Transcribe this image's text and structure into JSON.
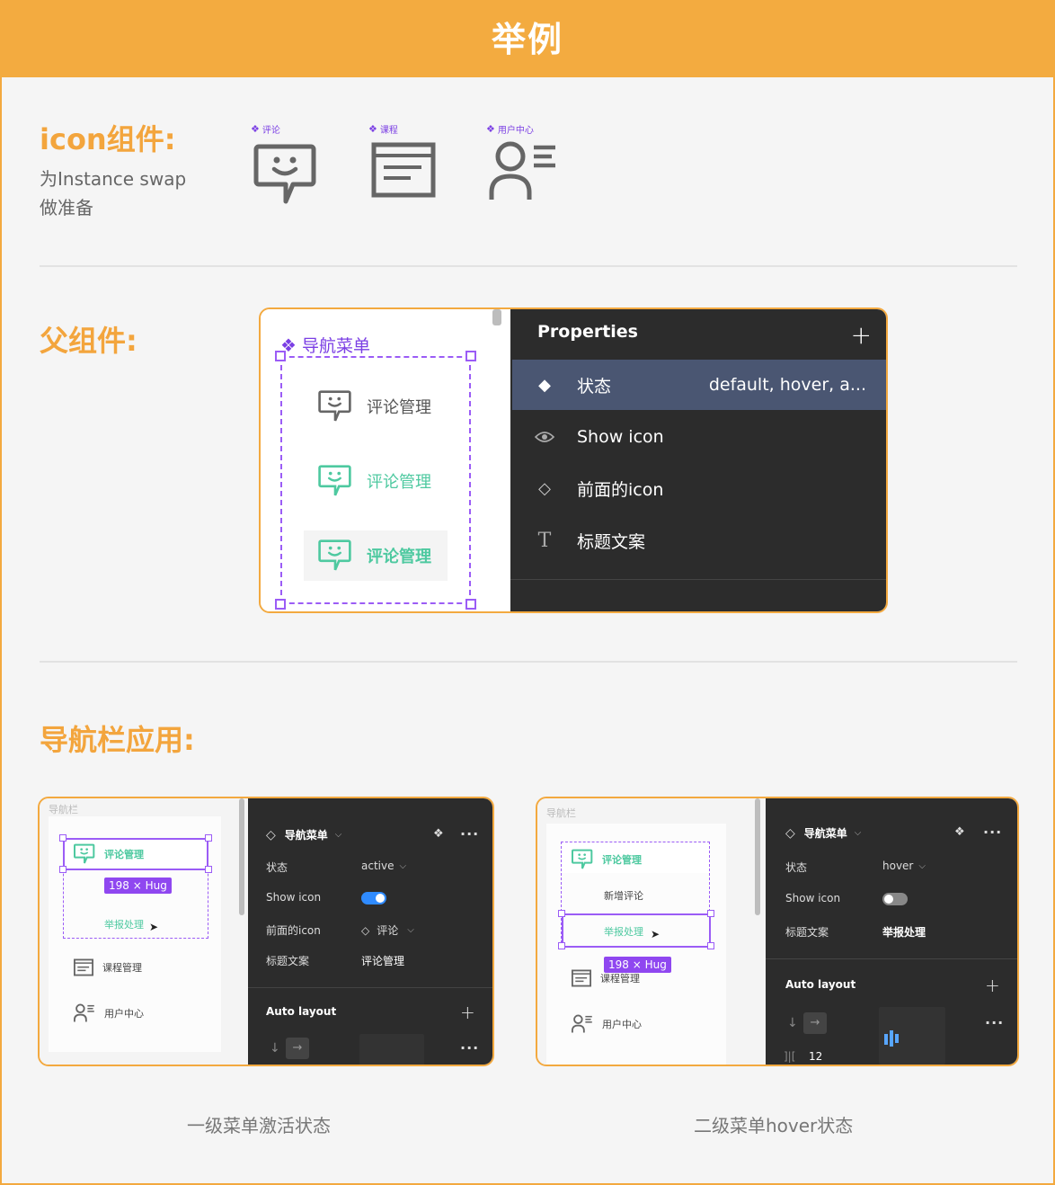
{
  "header": {
    "title": "举例"
  },
  "icon_section": {
    "title": "icon组件:",
    "desc_line1": "为Instance swap",
    "desc_line2": "做准备",
    "icons": [
      {
        "label": "评论",
        "icon": "comment-smile-icon"
      },
      {
        "label": "课程",
        "icon": "course-document-icon"
      },
      {
        "label": "用户中心",
        "icon": "user-center-icon"
      }
    ]
  },
  "parent_section": {
    "title": "父组件:",
    "component_name": "导航菜单",
    "menu_items": [
      "评论管理",
      "评论管理",
      "评论管理"
    ],
    "properties_title": "Properties",
    "properties": [
      {
        "label": "状态",
        "value": "default, hover, a..."
      },
      {
        "label": "Show icon",
        "value": ""
      },
      {
        "label": "前面的icon",
        "value": ""
      },
      {
        "label": "标题文案",
        "value": ""
      }
    ]
  },
  "nav_section": {
    "title": "导航栏应用:",
    "card1": {
      "frame_label": "导航栏",
      "item_active": "评论管理",
      "hug": "198 × Hug",
      "item_report": "举报处理",
      "item_course": "课程管理",
      "item_user": "用户中心",
      "panel_title": "导航菜单",
      "state_label": "状态",
      "state_value": "active",
      "show_icon_label": "Show icon",
      "front_icon_label": "前面的icon",
      "front_icon_value": "评论",
      "title_label": "标题文案",
      "title_value": "评论管理",
      "auto_layout": "Auto layout",
      "caption": "一级菜单激活状态"
    },
    "card2": {
      "frame_label": "导航栏",
      "item_comment": "评论管理",
      "item_new": "新增评论",
      "item_report": "举报处理",
      "hug": "198 × Hug",
      "item_course": "课程管理",
      "item_user": "用户中心",
      "panel_title": "导航菜单",
      "state_label": "状态",
      "state_value": "hover",
      "show_icon_label": "Show icon",
      "title_label": "标题文案",
      "title_value": "举报处理",
      "auto_layout": "Auto layout",
      "spacing": "12",
      "caption": "二级菜单hover状态"
    }
  },
  "colors": {
    "orange": "#f3ab40",
    "purple": "#7b3fe4",
    "green": "#4ec9a0",
    "dark": "#2c2c2c",
    "selected": "#4a5672"
  }
}
